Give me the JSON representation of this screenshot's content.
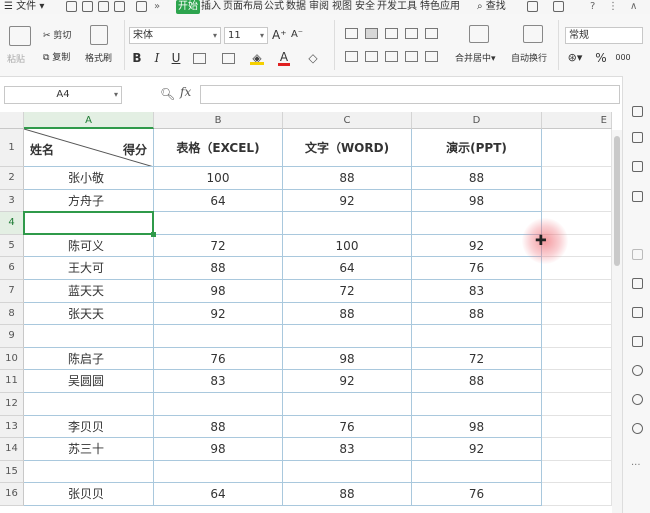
{
  "menubar": {
    "file_label": "文件",
    "tabs": [
      "开始",
      "插入",
      "页面布局",
      "公式",
      "数据",
      "审阅",
      "视图",
      "安全",
      "开发工具",
      "特色应用"
    ],
    "active_tab": "开始",
    "search_label": "查找"
  },
  "ribbon": {
    "paste_label": "粘贴",
    "cut_label": "剪切",
    "copy_label": "复制",
    "format_painter_label": "格式刷",
    "font_name": "宋体",
    "font_size": "11",
    "merge_label": "合并居中",
    "wrap_label": "自动换行",
    "number_format": "常规",
    "bold": "B",
    "italic": "I",
    "underline": "U",
    "grow_font": "A⁺",
    "shrink_font": "A⁻",
    "percent": "%",
    "thousands": "000",
    "accent_color": "#2da44e"
  },
  "formula_bar": {
    "name_box": "A4",
    "fx_label": "fx",
    "formula_value": ""
  },
  "sheet": {
    "columns": [
      "A",
      "B",
      "C",
      "D",
      "E"
    ],
    "row_numbers": [
      "1",
      "2",
      "3",
      "4",
      "5",
      "6",
      "7",
      "8",
      "9",
      "10",
      "11",
      "12",
      "13",
      "14",
      "15",
      "16"
    ],
    "header": {
      "a_left": "姓名",
      "a_right": "得分",
      "b": "表格（EXCEL)",
      "c": "文字（WORD)",
      "d": "演示(PPT)"
    },
    "rows": [
      {
        "name": "张小敬",
        "excel": "100",
        "word": "88",
        "ppt": "88"
      },
      {
        "name": "方舟子",
        "excel": "64",
        "word": "92",
        "ppt": "98"
      },
      {
        "name": "",
        "excel": "",
        "word": "",
        "ppt": ""
      },
      {
        "name": "陈可义",
        "excel": "72",
        "word": "100",
        "ppt": "92"
      },
      {
        "name": "王大可",
        "excel": "88",
        "word": "64",
        "ppt": "76"
      },
      {
        "name": "蓝天天",
        "excel": "98",
        "word": "72",
        "ppt": "83"
      },
      {
        "name": "张天天",
        "excel": "92",
        "word": "88",
        "ppt": "88"
      },
      {
        "name": "",
        "excel": "",
        "word": "",
        "ppt": ""
      },
      {
        "name": "陈启子",
        "excel": "76",
        "word": "98",
        "ppt": "72"
      },
      {
        "name": "吴圆圆",
        "excel": "83",
        "word": "92",
        "ppt": "88"
      },
      {
        "name": "",
        "excel": "",
        "word": "",
        "ppt": ""
      },
      {
        "name": "李贝贝",
        "excel": "88",
        "word": "76",
        "ppt": "98"
      },
      {
        "name": "苏三十",
        "excel": "98",
        "word": "83",
        "ppt": "92"
      },
      {
        "name": "",
        "excel": "",
        "word": "",
        "ppt": ""
      },
      {
        "name": "张贝贝",
        "excel": "64",
        "word": "88",
        "ppt": "76"
      }
    ],
    "selected_cell": "A4",
    "grid_color": "#a9c8dd",
    "selection_color": "#2f9a4a"
  }
}
